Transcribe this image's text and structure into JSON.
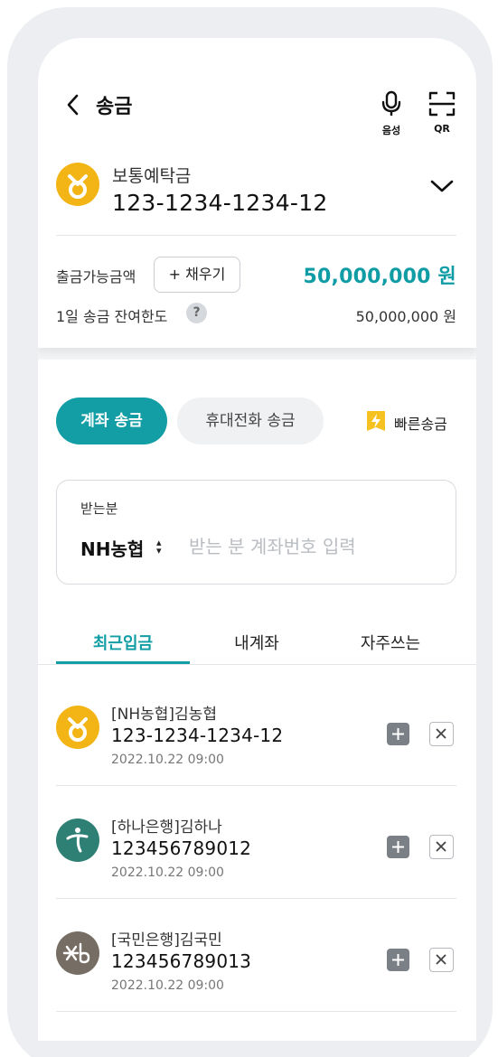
{
  "header": {
    "title": "송금",
    "voice_label": "음성",
    "qr_label": "QR"
  },
  "account": {
    "type": "보통예탁금",
    "number": "123-1234-1234-12"
  },
  "balance": {
    "available_label": "출금가능금액",
    "fill_button": "+ 채우기",
    "available_amount": "50,000,000 원",
    "limit_label": "1일 송금 잔여한도",
    "limit_amount": "50,000,000 원"
  },
  "transfer_tabs": {
    "account": "계좌 송금",
    "phone": "휴대전화 송금",
    "quick": "빠른송금"
  },
  "recipient": {
    "label": "받는분",
    "bank": "NH농협",
    "placeholder": "받는 분 계좌번호 입력"
  },
  "sub_tabs": [
    "최근입금",
    "내계좌",
    "자주쓰는"
  ],
  "recent": [
    {
      "name": "[NH농협]김농협",
      "account": "123-1234-1234-12",
      "date": "2022.10.22  09:00",
      "bank_icon": "nh-bank-icon",
      "color": "#f3b515"
    },
    {
      "name": "[하나은행]김하나",
      "account": "123456789012",
      "date": "2022.10.22  09:00",
      "bank_icon": "hana-bank-icon",
      "color": "#2e7f74"
    },
    {
      "name": "[국민은행]김국민",
      "account": "123456789013",
      "date": "2022.10.22  09:00",
      "bank_icon": "kb-bank-icon",
      "color": "#766d64"
    }
  ],
  "colors": {
    "accent": "#139ea6",
    "nh_yellow": "#f3b515",
    "hana_green": "#2e7f74",
    "kb_brown": "#766d64"
  }
}
